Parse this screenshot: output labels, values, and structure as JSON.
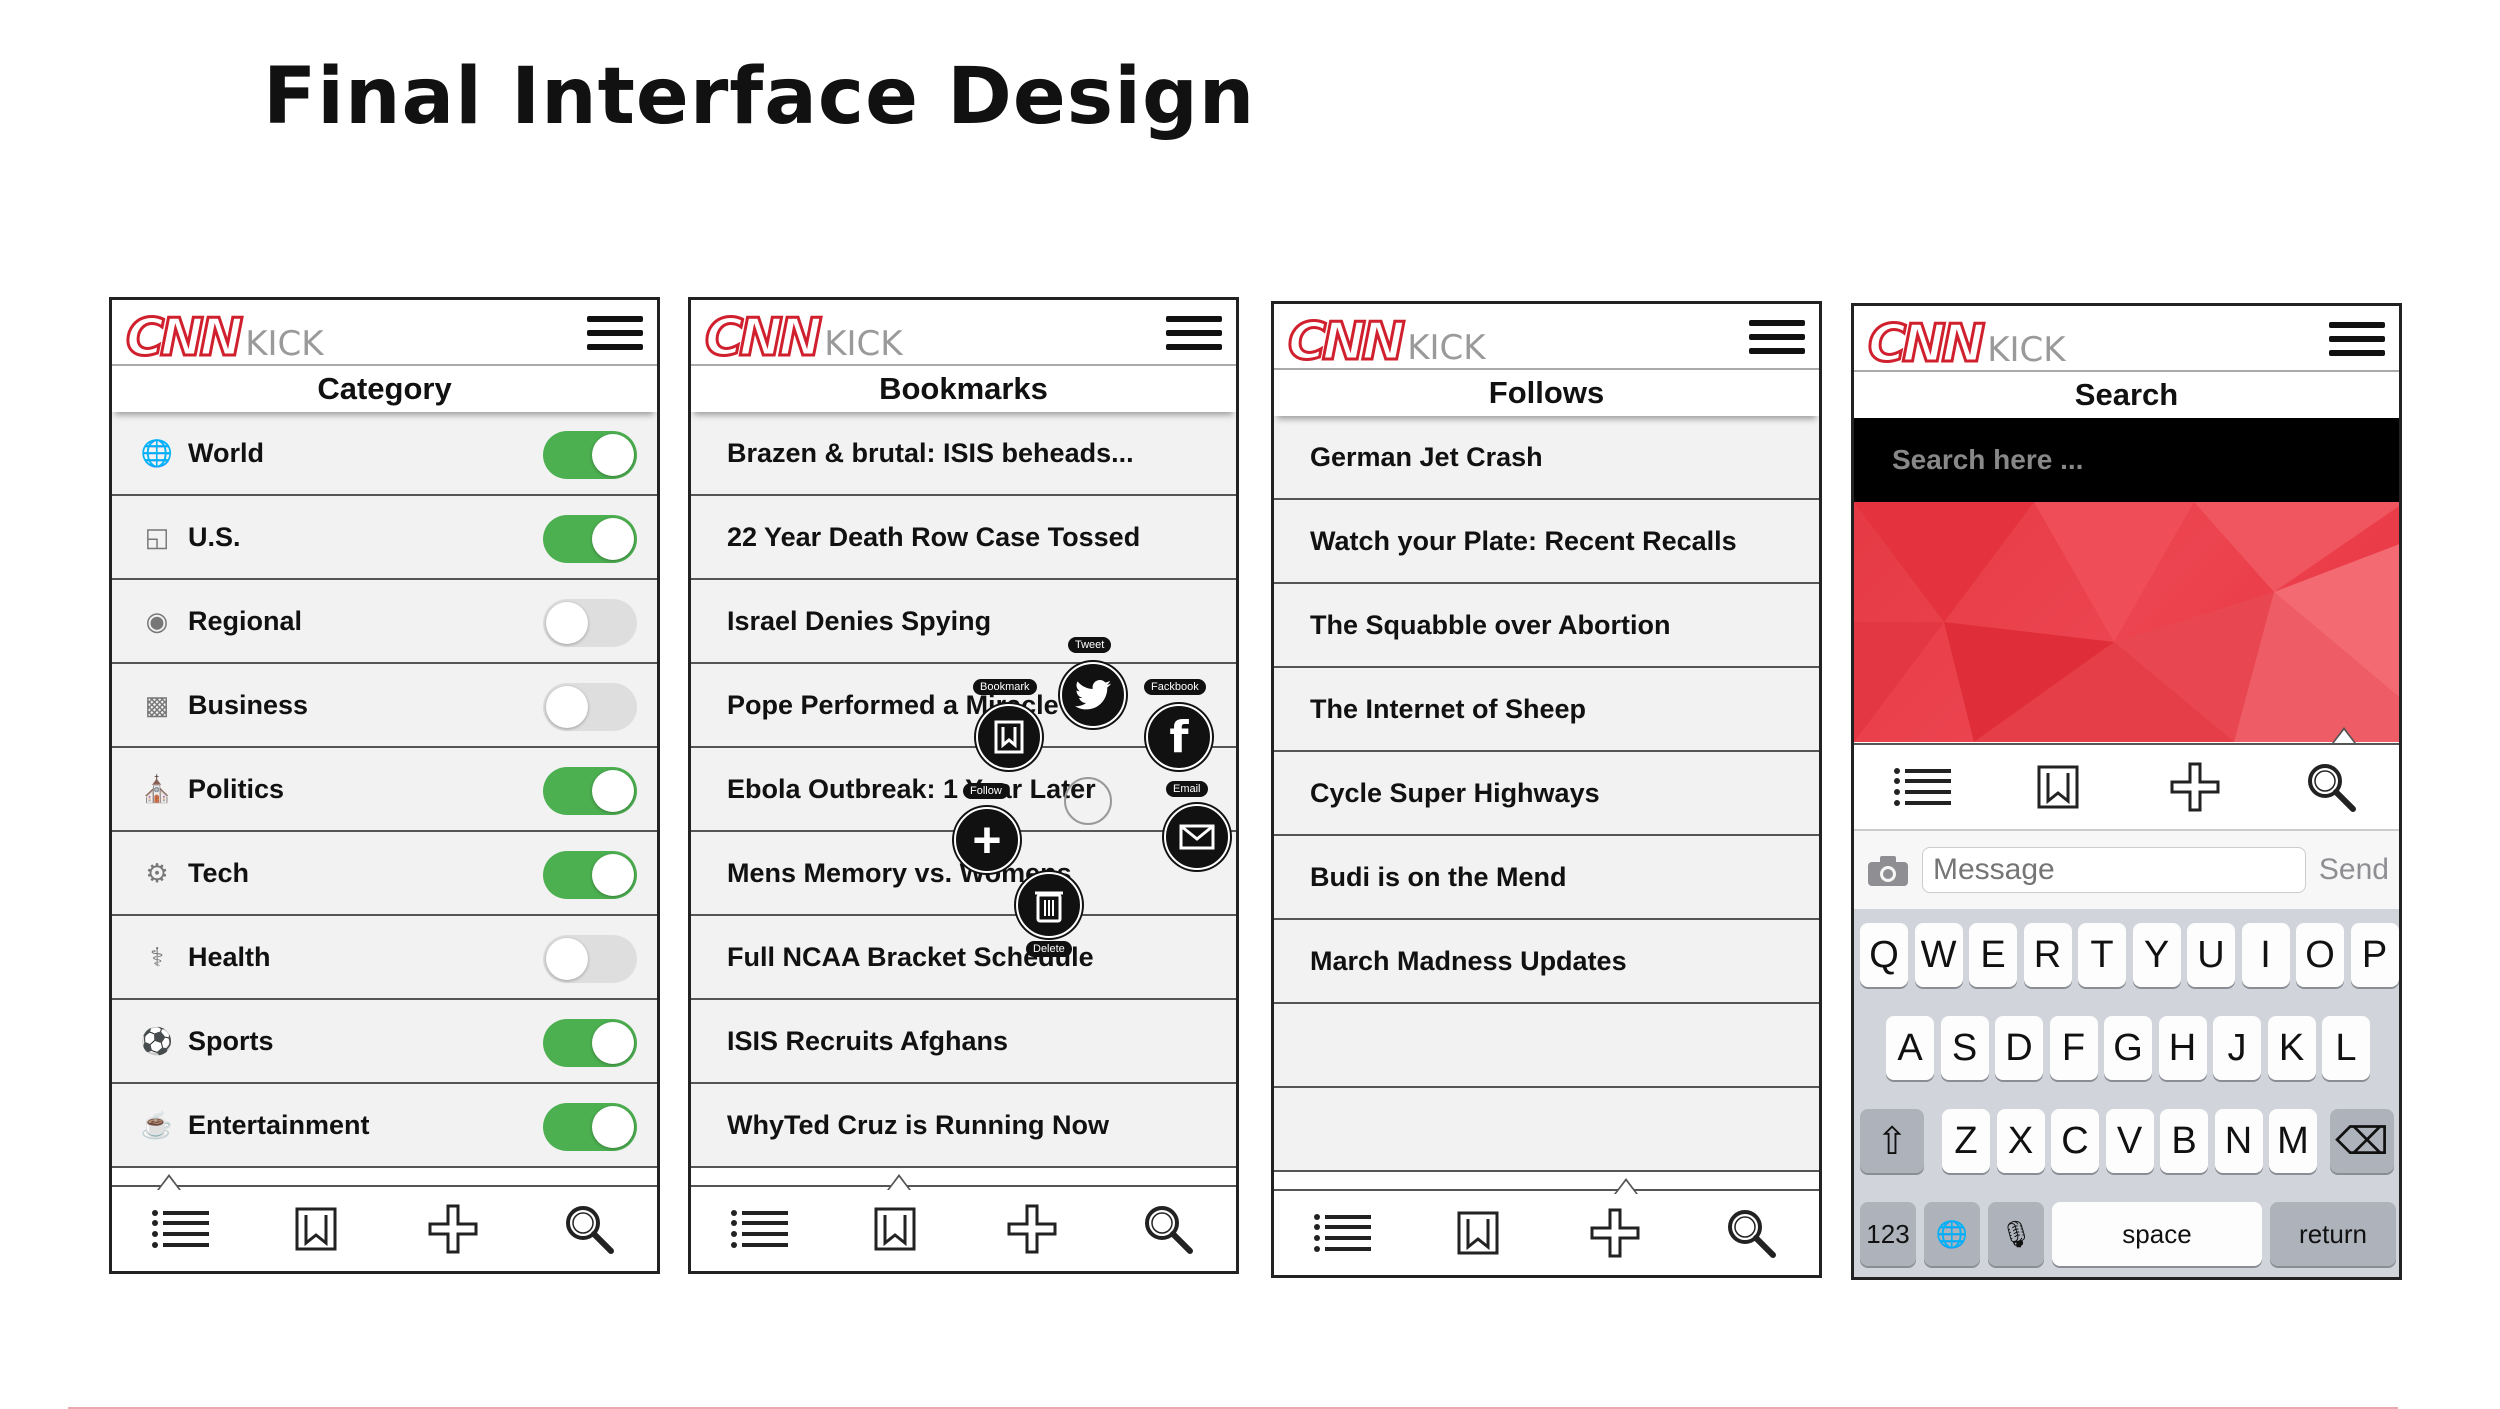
{
  "page_title": "Final Interface Design",
  "logo": {
    "brand": "CNN",
    "suffix": "KICK"
  },
  "screens": {
    "category": {
      "header": "Category",
      "items": [
        {
          "label": "World",
          "icon": "globe-icon",
          "on": true
        },
        {
          "label": "U.S.",
          "icon": "us-map-icon",
          "on": true
        },
        {
          "label": "Regional",
          "icon": "location-pin-icon",
          "on": false
        },
        {
          "label": "Business",
          "icon": "bar-chart-icon",
          "on": false
        },
        {
          "label": "Politics",
          "icon": "capitol-icon",
          "on": true
        },
        {
          "label": "Tech",
          "icon": "gear-globe-icon",
          "on": true
        },
        {
          "label": "Health",
          "icon": "caduceus-icon",
          "on": false
        },
        {
          "label": "Sports",
          "icon": "ball-icon",
          "on": true
        },
        {
          "label": "Entertainment",
          "icon": "coffee-cup-icon",
          "on": true
        }
      ]
    },
    "bookmarks": {
      "header": "Bookmarks",
      "items": [
        "Brazen & brutal: ISIS beheads...",
        "22 Year Death Row Case Tossed",
        "Israel Denies Spying",
        "Pope Performed a Miracle?",
        "Ebola Outbreak: 1 Year Later",
        "Mens Memory vs. Womens",
        "Full NCAA Bracket Schedule",
        "ISIS Recruits Afghans",
        "WhyTed Cruz is Running Now"
      ],
      "radial_menu": {
        "tweet": "Tweet",
        "facebook": "Fackbook",
        "bookmark": "Bookmark",
        "follow": "Follow",
        "email": "Email",
        "delete": "Delete"
      }
    },
    "follows": {
      "header": "Follows",
      "items": [
        "German Jet Crash",
        "Watch your Plate: Recent Recalls",
        "The Squabble over Abortion",
        "The Internet of Sheep",
        "Cycle Super Highways",
        "Budi is on the Mend",
        "March Madness Updates",
        "",
        ""
      ]
    },
    "search": {
      "header": "Search",
      "placeholder": "Search here ...",
      "message_placeholder": "Message",
      "send_label": "Send",
      "keyboard": {
        "row1": [
          "Q",
          "W",
          "E",
          "R",
          "T",
          "Y",
          "U",
          "I",
          "O",
          "P"
        ],
        "row2": [
          "A",
          "S",
          "D",
          "F",
          "G",
          "H",
          "J",
          "K",
          "L"
        ],
        "row3": [
          "Z",
          "X",
          "C",
          "V",
          "B",
          "N",
          "M"
        ],
        "numbers": "123",
        "space": "space",
        "return": "return"
      }
    }
  },
  "tabs": [
    "list-icon",
    "bookmark-book-icon",
    "plus-icon",
    "search-icon"
  ],
  "colors": {
    "accent": "#d0202e",
    "toggle_on": "#4caf50",
    "toggle_off": "#dedede",
    "hero": "#e53a45"
  }
}
